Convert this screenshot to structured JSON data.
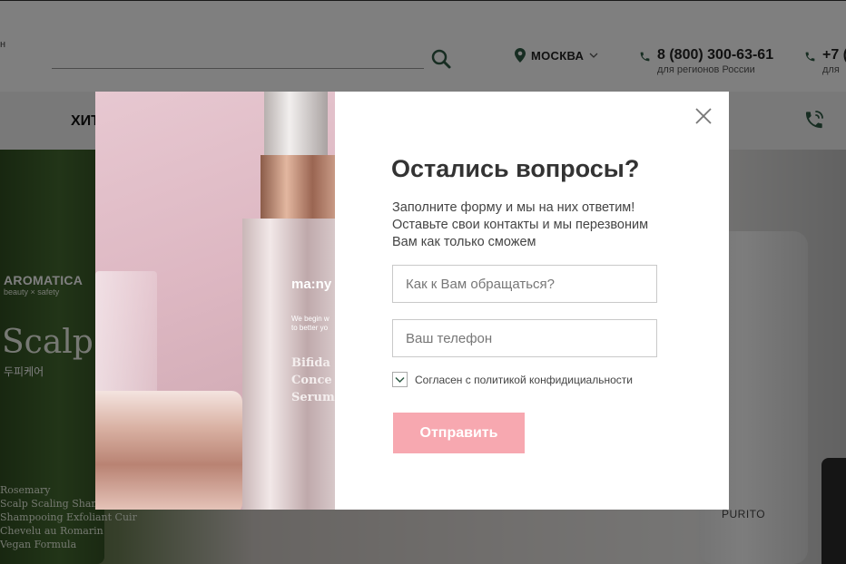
{
  "header": {
    "left_stub": "н",
    "city": "МОСКВА",
    "phones": [
      {
        "number": "8 (800) 300-63-61",
        "caption": "для регионов России"
      },
      {
        "number": "+7 (",
        "caption": "для"
      }
    ]
  },
  "nav": {
    "first_item": "ХИТ"
  },
  "hero": {
    "brand": "AROMATICA",
    "tagline": "beauty × safety",
    "product_word": "Scalp",
    "korean": "두피케어",
    "lines": [
      "Rosemary",
      "Scalp Scaling Sham",
      "Shampooing Exfoliant Cuir",
      "Chevelu au Romarin",
      "Vegan Formula"
    ],
    "right_brand": "PURITO"
  },
  "modal": {
    "photo": {
      "brand": "ma:ny",
      "small_text": [
        "We begin w",
        "to better yo"
      ],
      "name_lines": [
        "Bifida",
        "Conce",
        "Serum"
      ]
    },
    "title": "Остались вопросы?",
    "description": "Заполните форму и мы на них ответим! Оставьте свои контакты и мы перезвоним Вам как только сможем",
    "name_placeholder": "Как к Вам обращаться?",
    "phone_placeholder": "Ваш телефон",
    "consent_label": "Согласен с политикой конфидициальности",
    "consent_checked": true,
    "submit_label": "Отправить"
  },
  "colors": {
    "submit_button": "#f7a8b0",
    "icon_green": "#2f5a45",
    "title_text": "#333333"
  }
}
